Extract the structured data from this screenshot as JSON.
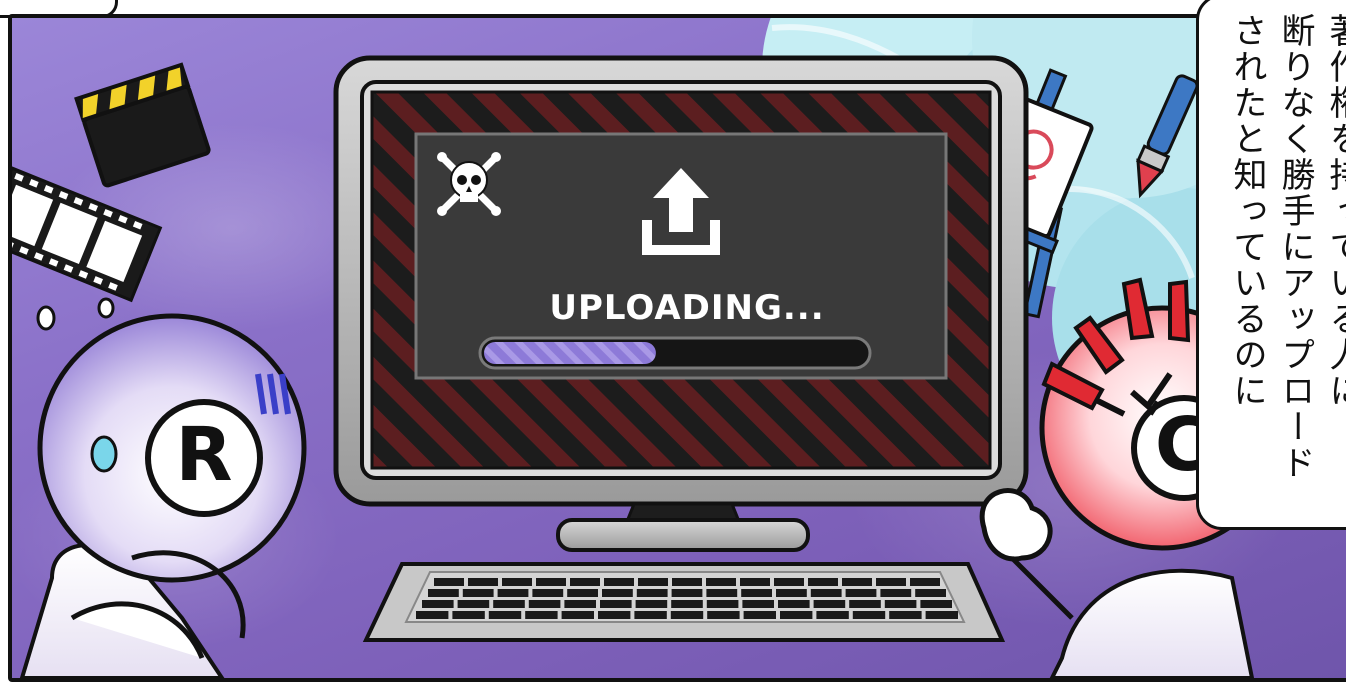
{
  "screen": {
    "status_text": "UPLOADING...",
    "progress_fraction": 0.45
  },
  "characters": {
    "left_symbol": "R",
    "right_symbol": "C"
  },
  "speech_bubble": {
    "lines": [
      "著作権を持っている人に",
      "断りなく勝手にアップロード",
      "されたと知っているのに"
    ]
  },
  "icons": [
    "skull-crossbones-icon",
    "upload-icon",
    "film-clapper-icon",
    "film-strip-icon",
    "easel-painting-icon",
    "paintbrush-icon",
    "sweat-drop-icon",
    "anger-mark-icon"
  ],
  "colors": {
    "background": "#8a70c8",
    "screen_dark": "#3a3a3a",
    "stripe_red": "#5c1e20",
    "progress_fill": "#8a78d8",
    "angry_red": "#e02a33",
    "cyan_blob": "#b7e6ee"
  }
}
